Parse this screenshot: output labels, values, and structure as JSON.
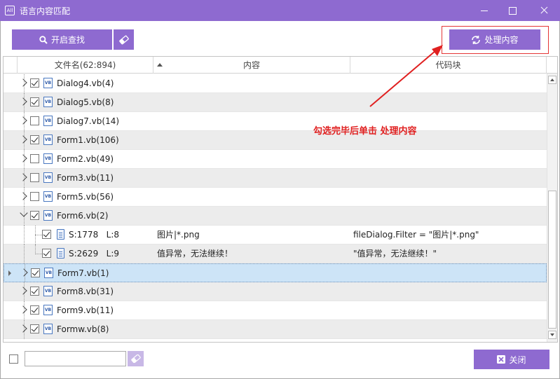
{
  "window": {
    "title": "语言内容匹配",
    "app_icon_text": "All"
  },
  "toolbar": {
    "search_label": "开启查找",
    "process_label": "处理内容"
  },
  "annotation": {
    "text": "勾选完毕后单击 处理内容"
  },
  "grid": {
    "headers": {
      "filename": "文件名(62:894)",
      "content": "内容",
      "codeblock": "代码块"
    },
    "rows": [
      {
        "name": "Dialog4.vb(4)",
        "checked": true,
        "expanded": false
      },
      {
        "name": "Dialog5.vb(8)",
        "checked": true,
        "expanded": false
      },
      {
        "name": "Dialog7.vb(14)",
        "checked": false,
        "expanded": false
      },
      {
        "name": "Form1.vb(106)",
        "checked": true,
        "expanded": false
      },
      {
        "name": "Form2.vb(49)",
        "checked": false,
        "expanded": false
      },
      {
        "name": "Form3.vb(11)",
        "checked": false,
        "expanded": false
      },
      {
        "name": "Form5.vb(56)",
        "checked": false,
        "expanded": false
      },
      {
        "name": "Form6.vb(2)",
        "checked": true,
        "expanded": true
      },
      {
        "pos": "S:1778   L:8",
        "content": "图片|*.png",
        "code": "fileDialog.Filter = \"图片|*.png\"",
        "checked": true,
        "child": true
      },
      {
        "pos": "S:2629   L:9",
        "content": "值异常，无法继续！",
        "code": "\"值异常，无法继续！\"",
        "checked": true,
        "child": true
      },
      {
        "name": "Form7.vb(1)",
        "checked": true,
        "expanded": false,
        "selected": true
      },
      {
        "name": "Form8.vb(31)",
        "checked": true,
        "expanded": false
      },
      {
        "name": "Form9.vb(11)",
        "checked": true,
        "expanded": false
      },
      {
        "name": "Formw.vb(8)",
        "checked": true,
        "expanded": false
      }
    ]
  },
  "footer": {
    "input_value": "",
    "close_label": "关闭"
  },
  "colors": {
    "accent": "#8e6ad0",
    "annotation": "#e02020",
    "selection": "#cde4f7"
  }
}
